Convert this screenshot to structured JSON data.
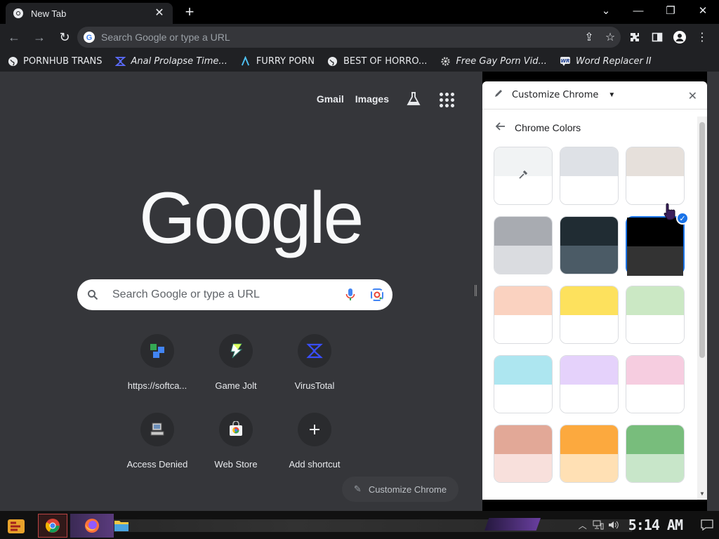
{
  "browser": {
    "tab_title": "New Tab",
    "omnibox_placeholder": "Search Google or type a URL",
    "bookmarks": [
      {
        "label": "PORNHUB TRANS",
        "icon": "globe-icon"
      },
      {
        "label": "Anal Prolapse Time...",
        "icon": "virustotal-icon"
      },
      {
        "label": "FURRY PORN",
        "icon": "lambda-icon"
      },
      {
        "label": "BEST OF HORRO...",
        "icon": "globe-icon"
      },
      {
        "label": "Free Gay Porn Vid...",
        "icon": "gear-icon"
      },
      {
        "label": "Word Replacer II",
        "icon": "wr-icon"
      }
    ]
  },
  "ntp": {
    "gmail": "Gmail",
    "images": "Images",
    "logo": "Google",
    "search_placeholder": "Search Google or type a URL",
    "shortcuts": [
      {
        "label": "https://softca...",
        "icon": "softcatala-icon"
      },
      {
        "label": "Game Jolt",
        "icon": "gamejolt-icon"
      },
      {
        "label": "VirusTotal",
        "icon": "virustotal-icon"
      },
      {
        "label": "Access Denied",
        "icon": "computer-icon"
      },
      {
        "label": "Web Store",
        "icon": "webstore-icon"
      },
      {
        "label": "Add shortcut",
        "icon": "plus-icon"
      }
    ],
    "customize_button": "Customize Chrome"
  },
  "panel": {
    "title": "Customize Chrome",
    "subtitle": "Chrome Colors",
    "swatches": [
      {
        "top": "#f1f3f4",
        "bottom": "#ffffff",
        "custom": true
      },
      {
        "top": "#dee1e6",
        "bottom": "#ffffff"
      },
      {
        "top": "#e6e0db",
        "bottom": "#ffffff"
      },
      {
        "top": "#a8abb1",
        "bottom": "#dadce0"
      },
      {
        "top": "#202c33",
        "bottom": "#4b5b66"
      },
      {
        "top": "#000000",
        "bottom": "#333333",
        "selected": true
      },
      {
        "top": "#fad2c0",
        "bottom": "#ffffff"
      },
      {
        "top": "#fde15d",
        "bottom": "#ffffff"
      },
      {
        "top": "#cbe8c4",
        "bottom": "#ffffff"
      },
      {
        "top": "#ade6f0",
        "bottom": "#ffffff"
      },
      {
        "top": "#e5d2fb",
        "bottom": "#ffffff"
      },
      {
        "top": "#f6cde0",
        "bottom": "#ffffff"
      },
      {
        "top": "#e2a897",
        "bottom": "#f8e0dc"
      },
      {
        "top": "#fca93e",
        "bottom": "#ffe0b4"
      },
      {
        "top": "#78bd7c",
        "bottom": "#c8e6c9"
      }
    ]
  },
  "taskbar": {
    "clock": "5:14 AM"
  }
}
